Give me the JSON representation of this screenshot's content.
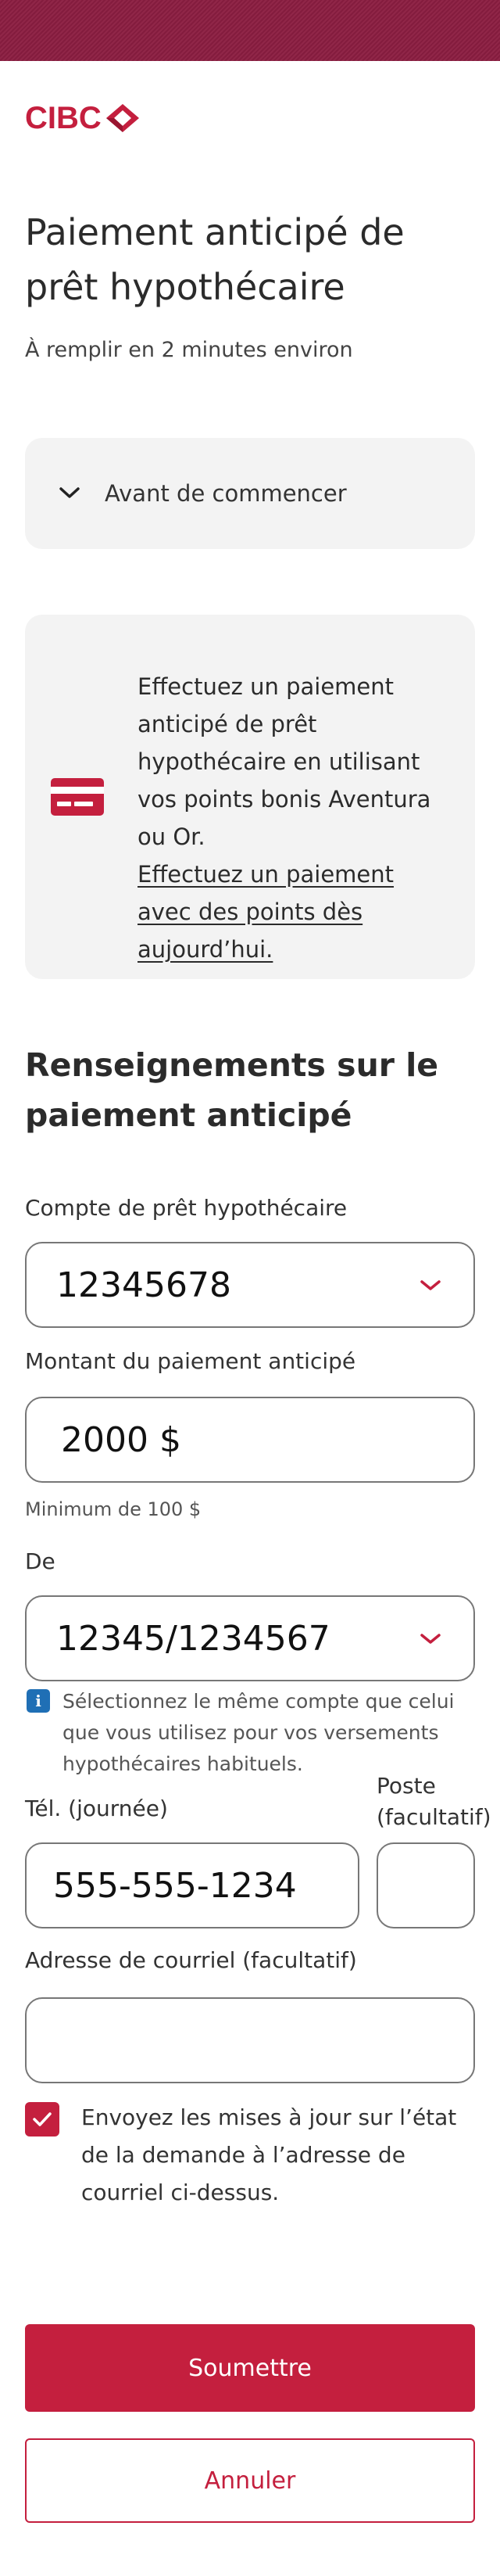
{
  "brand": {
    "name": "CIBC",
    "color": "#c41f3e",
    "topbar_color": "#8b1d41"
  },
  "header": {
    "title": "Paiement anticipé de prêt hypothécaire",
    "subtitle": "À remplir en 2 minutes environ"
  },
  "accordion": {
    "label": "Avant de commencer",
    "icon": "chevron-down-icon"
  },
  "promo": {
    "icon": "credit-card-icon",
    "text": "Effectuez un paiement anticipé de prêt hypothécaire en utilisant vos points bonis Aventura ou Or.",
    "link": "Effectuez un paiement avec des points dès aujourd’hui."
  },
  "form": {
    "section_title": "Renseignements sur le paiement anticipé",
    "mortgage_account": {
      "label": "Compte de prêt hypothécaire",
      "value": "12345678"
    },
    "prepayment_amount": {
      "label": "Montant du paiement anticipé",
      "value": "2000 $",
      "hint": "Minimum de 100 $"
    },
    "from_account": {
      "label": "De",
      "value": "12345/1234567",
      "info": "Sélectionnez le même compte que celui que vous utilisez pour vos versements hypothécaires habituels."
    },
    "phone": {
      "label": "Tél. (journée)",
      "value": "555-555-1234"
    },
    "extension": {
      "label": "Poste (facultatif)",
      "value": ""
    },
    "email": {
      "label": "Adresse de courriel (facultatif)",
      "value": ""
    },
    "updates_checkbox": {
      "checked": true,
      "label": "Envoyez les mises à jour sur l’état de la demande à l’adresse de courriel ci-dessus."
    }
  },
  "actions": {
    "submit": "Soumettre",
    "cancel": "Annuler"
  }
}
